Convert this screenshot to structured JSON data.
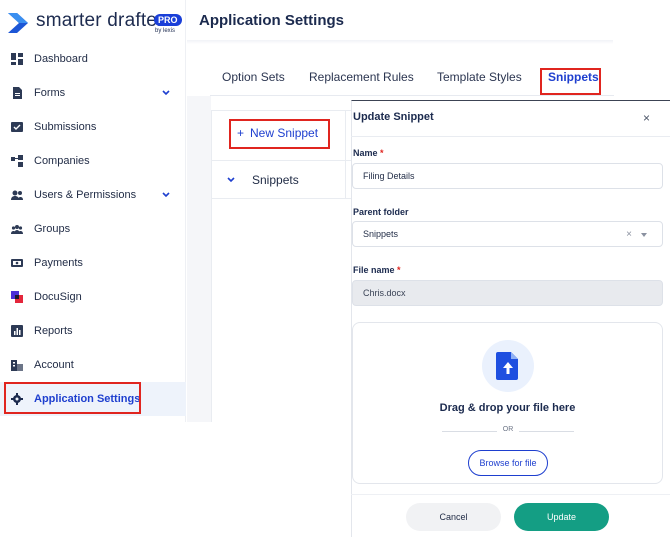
{
  "brand": {
    "name": "smarter drafter",
    "badge": "PRO",
    "byline": "by lexis",
    "accent_color": "#1a3fd8"
  },
  "sidebar": {
    "items": [
      {
        "label": "Dashboard",
        "icon": "dashboard-icon",
        "expandable": false
      },
      {
        "label": "Forms",
        "icon": "document-icon",
        "expandable": true
      },
      {
        "label": "Submissions",
        "icon": "inbox-check-icon",
        "expandable": false
      },
      {
        "label": "Companies",
        "icon": "companies-icon",
        "expandable": false
      },
      {
        "label": "Users & Permissions",
        "icon": "users-icon",
        "expandable": true
      },
      {
        "label": "Groups",
        "icon": "group-icon",
        "expandable": false
      },
      {
        "label": "Payments",
        "icon": "payment-icon",
        "expandable": false
      },
      {
        "label": "DocuSign",
        "icon": "docusign-icon",
        "expandable": false
      },
      {
        "label": "Reports",
        "icon": "reports-icon",
        "expandable": false
      },
      {
        "label": "Account",
        "icon": "building-icon",
        "expandable": false
      },
      {
        "label": "Application Settings",
        "icon": "gear-icon",
        "expandable": false,
        "active": true
      }
    ]
  },
  "header": {
    "title": "Application Settings"
  },
  "tabs": [
    {
      "label": "Option Sets"
    },
    {
      "label": "Replacement Rules"
    },
    {
      "label": "Template Styles"
    },
    {
      "label": "Snippets",
      "active": true
    }
  ],
  "snippets_panel": {
    "new_label": "New Snippet",
    "new_prefix": "+",
    "folder_label": "Snippets"
  },
  "modal": {
    "title": "Update Snippet",
    "close_glyph": "×",
    "name_label": "Name",
    "name_value": "Filing Details",
    "required_mark": "*",
    "parent_label": "Parent folder",
    "parent_value": "Snippets",
    "parent_clear": "×",
    "filename_label": "File name",
    "filename_value": "Chris.docx",
    "drop_text": "Drag & drop your file here",
    "or_text": "OR",
    "browse_label": "Browse for file",
    "cancel_label": "Cancel",
    "update_label": "Update",
    "update_color": "#149e84"
  },
  "highlight_color": "#e0251f"
}
